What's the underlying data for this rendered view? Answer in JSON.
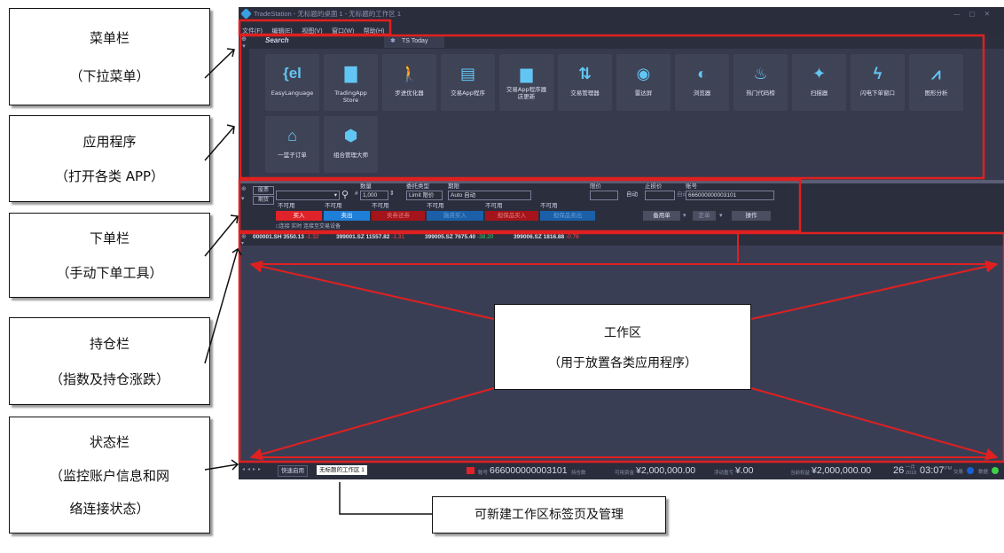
{
  "annotations": [
    {
      "id": "menu",
      "line1": "菜单栏",
      "line2": "（下拉菜单）"
    },
    {
      "id": "apps",
      "line1": "应用程序",
      "line2": "（打开各类 APP）"
    },
    {
      "id": "order",
      "line1": "下单栏",
      "line2": "（手动下单工具）"
    },
    {
      "id": "positions",
      "line1": "持仓栏",
      "line2": "（指数及持仓涨跌）"
    },
    {
      "id": "status",
      "line1": "状态栏",
      "line2": "（监控账户信息和网",
      "line3": "络连接状态）"
    }
  ],
  "workspace_callout": {
    "line1": "工作区",
    "line2": "（用于放置各类应用程序）"
  },
  "tab_callout": "可新建工作区标签页及管理",
  "window": {
    "title": "TradeStation - 无标题的桌面 1 - 无标题的工作区 1"
  },
  "menu": [
    "文件(F)",
    "编辑(E)",
    "视图(V)",
    "窗口(W)",
    "帮助(H)"
  ],
  "apps_panel": {
    "search": "Search",
    "ts_today": "TS Today"
  },
  "apps": [
    {
      "label": "EasyLanguage",
      "icon": "easylanguage-icon"
    },
    {
      "label": "TradingApp Store",
      "icon": "store-icon"
    },
    {
      "label": "步进优化器",
      "icon": "walker-icon"
    },
    {
      "label": "交易App程序",
      "icon": "document-icon"
    },
    {
      "label": "交易App程序器 店更新",
      "icon": "store-update-icon"
    },
    {
      "label": "交易管理器",
      "icon": "trade-manager-icon"
    },
    {
      "label": "雷达屏",
      "icon": "radar-icon"
    },
    {
      "label": "浏览器",
      "icon": "browser-icon"
    },
    {
      "label": "热门代码榜",
      "icon": "fire-icon"
    },
    {
      "label": "扫描器",
      "icon": "scanner-icon"
    },
    {
      "label": "闪电下单窗口",
      "icon": "lightning-icon"
    },
    {
      "label": "图形分析",
      "icon": "chart-analysis-icon"
    },
    {
      "label": "一篮子订单",
      "icon": "basket-icon"
    },
    {
      "label": "组合管理大师",
      "icon": "portfolio-icon"
    }
  ],
  "order": {
    "side_stock": "股票",
    "side_futures": "期货",
    "label_qty": "数量",
    "label_type": "委托类型",
    "label_period": "期限",
    "label_limit": "限价",
    "label_stop": "止损价",
    "label_account": "账号",
    "qty": "1,000",
    "type": "Limit 限价",
    "period": "Auto 自动",
    "auto1": "自动",
    "auto2": "自动",
    "account": "666000000003101",
    "unavailable": "不可用",
    "buy": "买入",
    "sell": "卖出",
    "sell_short": "卖券还券",
    "buy_cover": "融资买入",
    "guarantee_buy": "担保品买入",
    "guarantee_sell": "担保品卖出",
    "spare": "备用单",
    "order": "定单",
    "action": "操作",
    "link_note": "□连接   实时   连接至交易设备"
  },
  "tickers": [
    {
      "code": "000001.SH",
      "price": "3550.13",
      "chg": "-1.32",
      "dir": "down"
    },
    {
      "code": "399001.SZ",
      "price": "11557.82",
      "chg": "-1.31",
      "dir": "down"
    },
    {
      "code": "399005.SZ",
      "price": "7675.40",
      "chg": "-38.20",
      "dir": "up"
    },
    {
      "code": "399006.SZ",
      "price": "1816.88",
      "chg": "-0.76",
      "dir": "down"
    }
  ],
  "status": {
    "tab_quick": "快速启用",
    "tab_workspace": "无标题的工作区 1",
    "account_label": "账号",
    "account": "666000000003101",
    "holding_label": "持仓数",
    "avail_label": "可用资金",
    "avail": "¥2,000,000.00",
    "floating_label": "浮动盈亏",
    "floating": "¥.00",
    "equity_label": "当前权益",
    "equity": "¥2,000,000.00",
    "day": "26",
    "month": "一月",
    "year": "2018",
    "time": "03:07",
    "ampm": "PM",
    "exchange": "交易",
    "data": "数据"
  },
  "colors": {
    "buy": "#e0232a",
    "sell": "#1f7fd8",
    "red_outline": "#e02020",
    "window_bg": "#2e3142"
  }
}
